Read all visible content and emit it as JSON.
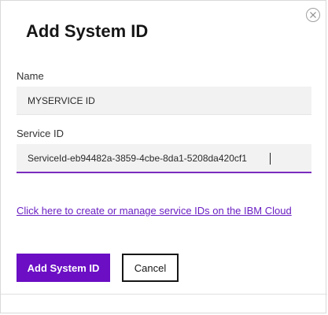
{
  "dialog": {
    "title": "Add System ID",
    "close_icon": "close-circle-icon",
    "name_field": {
      "label": "Name",
      "value": "MYSERVICE ID"
    },
    "service_id_field": {
      "label": "Service ID",
      "value": "ServiceId-eb94482a-3859-4cbe-8da1-5208da420cf1"
    },
    "manage_link": "Click here to create or manage service IDs on the IBM Cloud",
    "buttons": {
      "primary_label": "Add System ID",
      "cancel_label": "Cancel"
    }
  },
  "colors": {
    "primary": "#6b0ec4",
    "link": "#6a1fc2",
    "focus_border": "#7a2bbf",
    "input_bg": "#f2f2f2",
    "text": "#161616"
  }
}
